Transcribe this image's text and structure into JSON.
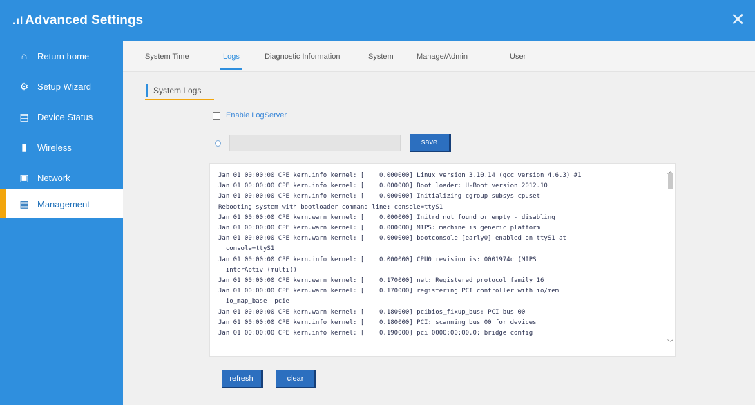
{
  "window": {
    "logo": ".ıl",
    "title": "Advanced Settings",
    "close_glyph": "✕"
  },
  "sidebar": {
    "items": [
      {
        "label": "Return home",
        "icon": "home-icon",
        "glyph": "⌂"
      },
      {
        "label": "Setup Wizard",
        "icon": "wizard-icon",
        "glyph": "⚙"
      },
      {
        "label": "Device Status",
        "icon": "status-icon",
        "glyph": "▤"
      },
      {
        "label": "Wireless",
        "icon": "signal-icon",
        "glyph": "▮"
      },
      {
        "label": "Network",
        "icon": "network-icon",
        "glyph": "▣"
      },
      {
        "label": "Management",
        "icon": "management-icon",
        "glyph": "▦"
      }
    ],
    "active_index": 5
  },
  "tabs": [
    {
      "label": "System Time"
    },
    {
      "label": "Logs"
    },
    {
      "label": "Diagnostic Information"
    },
    {
      "label": "System"
    },
    {
      "label": "Manage/Admin"
    },
    {
      "label": "User"
    }
  ],
  "active_tab": "Logs",
  "section": {
    "title": "System Logs"
  },
  "remote_log": {
    "label": "Enable LogServer",
    "checked": false
  },
  "server": {
    "value": "",
    "save_label": "save"
  },
  "log": {
    "lines": [
      "Jan 01 00:00:00 CPE kern.info kernel: [    0.000000] Linux version 3.10.14 (gcc version 4.6.3) #1",
      "Jan 01 00:00:00 CPE kern.info kernel: [    0.000000] Boot loader: U-Boot version 2012.10",
      "Jan 01 00:00:00 CPE kern.info kernel: [    0.000000] Initializing cgroup subsys cpuset",
      "Rebooting system with bootloader command line: console=ttyS1",
      "Jan 01 00:00:00 CPE kern.warn kernel: [    0.000000] Initrd not found or empty - disabling",
      "Jan 01 00:00:00 CPE kern.warn kernel: [    0.000000] MIPS: machine is generic platform",
      "Jan 01 00:00:00 CPE kern.warn kernel: [    0.000000] bootconsole [early0] enabled on ttyS1 at",
      "  console=ttyS1",
      "Jan 01 00:00:00 CPE kern.info kernel: [    0.000000] CPU0 revision is: 0001974c (MIPS",
      "  interAptiv (multi))",
      "Jan 01 00:00:00 CPE kern.warn kernel: [    0.170000] net: Registered protocol family 16",
      "Jan 01 00:00:00 CPE kern.warn kernel: [    0.170000] registering PCI controller with io/mem",
      "  io_map_base  pcie",
      "Jan 01 00:00:00 CPE kern.warn kernel: [    0.180000] pcibios_fixup_bus: PCI bus 00",
      "Jan 01 00:00:00 CPE kern.info kernel: [    0.180000] PCI: scanning bus 00 for devices",
      "Jan 01 00:00:00 CPE kern.info kernel: [    0.190000] pci 0000:00:00.0: bridge config"
    ]
  },
  "actions": {
    "refresh_label": "refresh",
    "clear_label": "clear"
  },
  "colors": {
    "primary": "#2f8fde",
    "accent": "#f2a50c",
    "button": "#2c6fbf"
  }
}
